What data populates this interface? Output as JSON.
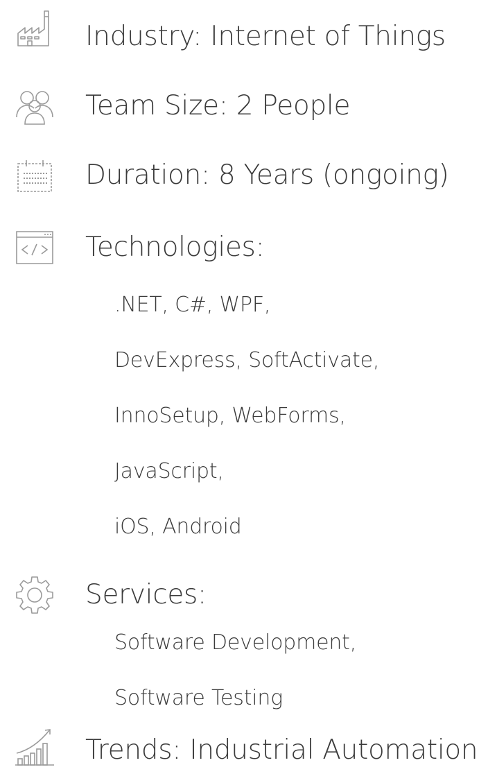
{
  "industry": {
    "icon": "factory-icon",
    "text": "Industry: Internet of Things"
  },
  "team": {
    "icon": "team-icon",
    "text": "Team Size: 2 People"
  },
  "duration": {
    "icon": "calendar-icon",
    "text": "Duration: 8 Years (ongoing)"
  },
  "technologies": {
    "icon": "code-window-icon",
    "text": "Technologies:",
    "items": [
      ".NET, C#, WPF,",
      "DevExpress, SoftActivate,",
      "InnoSetup, WebForms,",
      "JavaScript,",
      "iOS, Android"
    ]
  },
  "services": {
    "icon": "gear-icon",
    "text": "Services:",
    "items": [
      "Software Development,",
      "Software Testing"
    ]
  },
  "trends": {
    "icon": "growth-chart-icon",
    "text": "Trends: Industrial Automation"
  },
  "colors": {
    "text": "#3b3b3b",
    "icon": "#9a9a9a"
  }
}
